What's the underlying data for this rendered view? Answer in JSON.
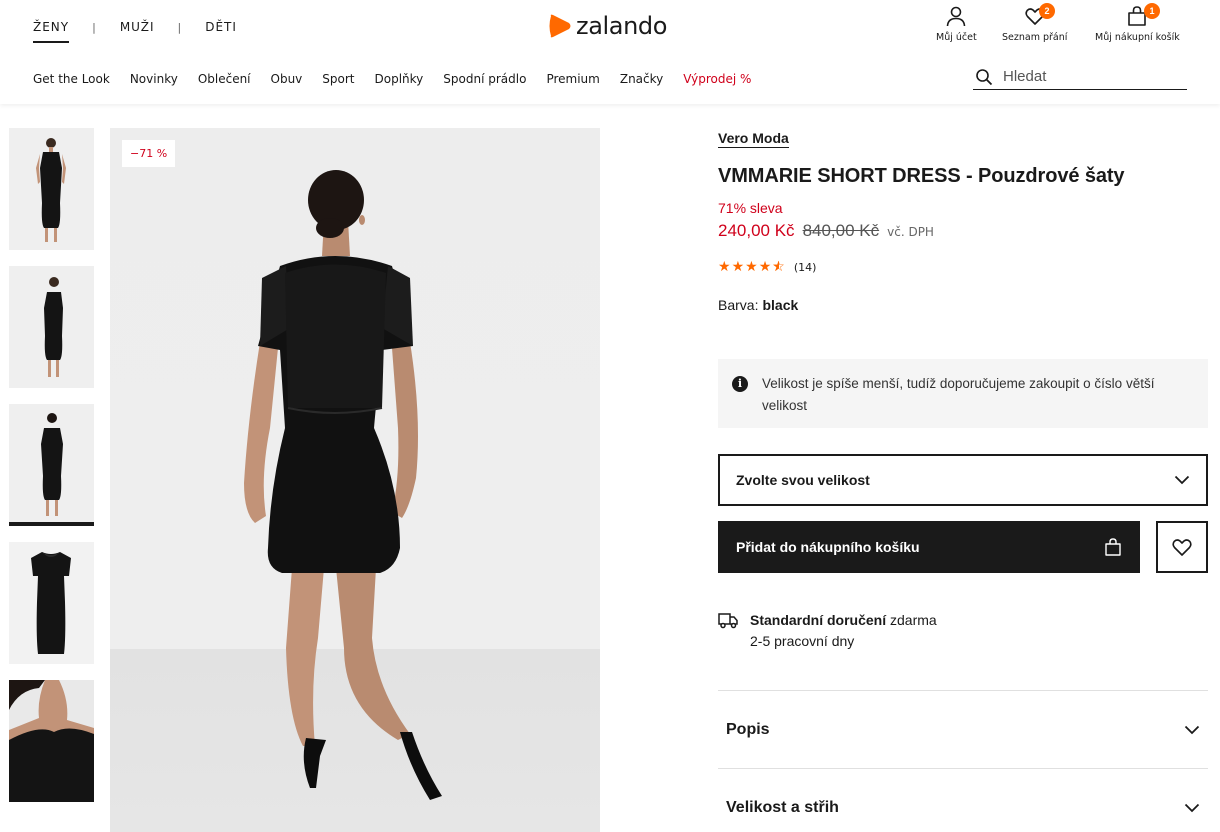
{
  "header": {
    "gender_tabs": [
      "ŽENY",
      "MUŽI",
      "DĚTI"
    ],
    "separator": "|",
    "logo_text": "zalando",
    "account_label": "Můj účet",
    "wishlist_label": "Seznam přání",
    "wishlist_count": "2",
    "cart_label": "Můj nákupní košík",
    "cart_count": "1",
    "categories": [
      "Get the Look",
      "Novinky",
      "Oblečení",
      "Obuv",
      "Sport",
      "Doplňky",
      "Spodní prádlo",
      "Premium",
      "Značky",
      "Výprodej %"
    ],
    "search_placeholder": "Hledat"
  },
  "gallery": {
    "discount_flag": "−71 %",
    "thumbnail_count": 5,
    "active_thumbnail": 3
  },
  "product": {
    "brand": "Vero Moda",
    "title": "VMMARIE SHORT DRESS - Pouzdrové šaty",
    "discount_text": "71% sleva",
    "price": "240,00 Kč",
    "original_price": "840,00 Kč",
    "vat_note": "vč. DPH",
    "rating_stars": 4.5,
    "review_count": "(14)",
    "color_label": "Barva:",
    "color_value": "black",
    "size_notice": "Velikost je spíše menší, tudíž doporučujeme zakoupit o číslo větší velikost",
    "size_select": "Zvolte svou velikost",
    "add_to_cart": "Přidat do nákupního košíku",
    "delivery_title": "Standardní doručení",
    "delivery_price": "zdarma",
    "delivery_time": "2-5 pracovní dny",
    "accordions": [
      "Popis",
      "Velikost a střih"
    ]
  },
  "colors": {
    "accent": "#ff6900",
    "sale": "#d0011b",
    "text": "#1a1a1a"
  }
}
